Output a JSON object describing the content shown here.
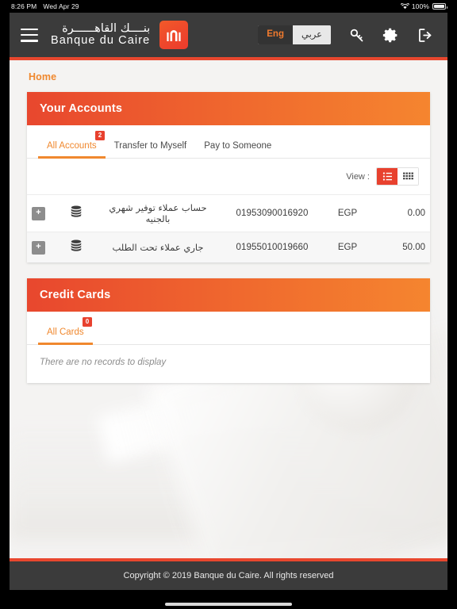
{
  "statusbar": {
    "time": "8:26 PM",
    "date": "Wed Apr 29",
    "battery_percent": "100%",
    "wifi_icon": "wifi-icon",
    "battery_icon": "battery-full-icon"
  },
  "header": {
    "menu_icon": "hamburger-menu-icon",
    "brand_ar": "بنــــك القاهــــــرة",
    "brand_en": "Banque du Caire",
    "logo_icon": "banque-du-caire-logo-icon",
    "lang": {
      "en": "Eng",
      "ar": "عربي",
      "active": "Eng"
    },
    "icons": [
      {
        "name": "key-icon",
        "label": "Change password"
      },
      {
        "name": "gear-icon",
        "label": "Settings"
      },
      {
        "name": "logout-icon",
        "label": "Logout"
      }
    ],
    "accent_color": "#e8472e",
    "bar_color": "#3b3b3b"
  },
  "breadcrumb": {
    "label": "Home"
  },
  "accounts_panel": {
    "title": "Your Accounts",
    "tabs": [
      {
        "label": "All Accounts",
        "badge": "2",
        "active": true
      },
      {
        "label": "Transfer to Myself",
        "badge": "",
        "active": false
      },
      {
        "label": "Pay to Someone",
        "badge": "",
        "active": false
      }
    ],
    "view": {
      "label": "View :",
      "options": [
        {
          "name": "list-view",
          "active": true
        },
        {
          "name": "grid-view",
          "active": false
        }
      ]
    },
    "rows": [
      {
        "expand": "+",
        "icon": "coins-stack-icon",
        "name": "حساب عملاء توفير شهري بالجنيه",
        "number": "01953090016920",
        "currency": "EGP",
        "balance": "0.00"
      },
      {
        "expand": "+",
        "icon": "coins-stack-icon",
        "name": "جاري عملاء تحت الطلب",
        "number": "01955010019660",
        "currency": "EGP",
        "balance": "50.00"
      }
    ]
  },
  "cards_panel": {
    "title": "Credit Cards",
    "tabs": [
      {
        "label": "All Cards",
        "badge": "0",
        "active": true
      }
    ],
    "empty_message": "There are no records to display"
  },
  "footer": {
    "copyright": "Copyright © 2019 Banque du Caire. All rights reserved"
  },
  "colors": {
    "accent_orange": "#f0882e",
    "accent_red": "#e8412e",
    "panel_gradient_from": "#e8472e",
    "panel_gradient_to": "#f5852f",
    "dark": "#3b3b3b",
    "page_bg": "#f4f3f2"
  }
}
